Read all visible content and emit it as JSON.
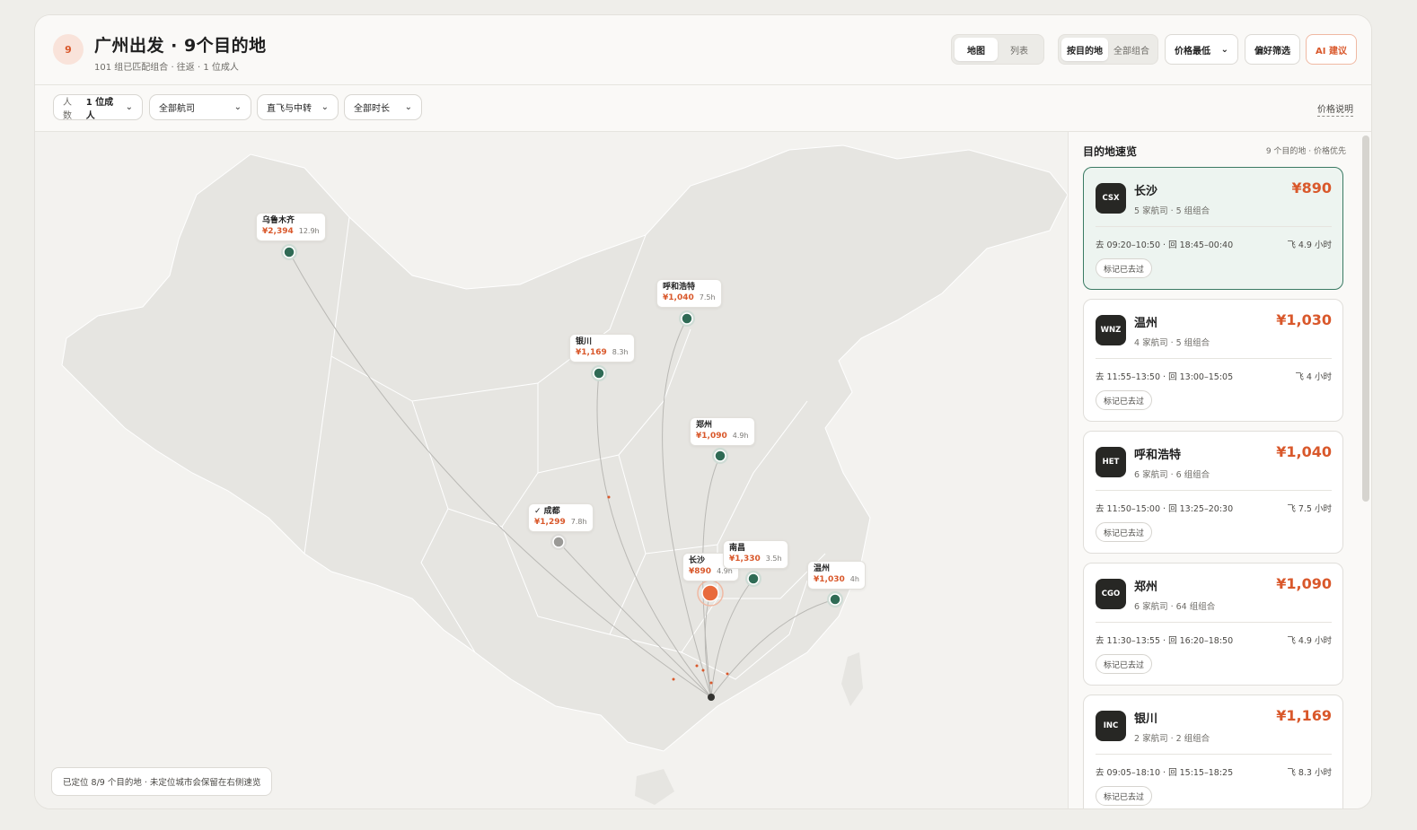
{
  "header": {
    "count": "9",
    "title": "广州出发 · 9个目的地",
    "subtitle": "101 组已匹配组合 · 往返 · 1 位成人",
    "view_toggle": [
      "地图",
      "列表"
    ],
    "group_toggle": [
      "按目的地",
      "全部组合"
    ],
    "sort_label": "价格最低",
    "prefs_label": "偏好筛选",
    "ai_label": "AI 建议"
  },
  "filters": {
    "people_label": "人数",
    "people_value": "1 位成人",
    "airline": "全部航司",
    "stops": "直飞与中转",
    "duration": "全部时长",
    "price_note": "价格说明"
  },
  "map": {
    "origin": "广州",
    "cities": [
      {
        "name": "乌鲁木齐",
        "price": "¥2,394",
        "hours": "12.9h",
        "status": "located"
      },
      {
        "name": "呼和浩特",
        "price": "¥1,040",
        "hours": "7.5h",
        "status": "located"
      },
      {
        "name": "银川",
        "price": "¥1,169",
        "hours": "8.3h",
        "status": "located"
      },
      {
        "name": "郑州",
        "price": "¥1,090",
        "hours": "4.9h",
        "status": "located"
      },
      {
        "name": "✓ 成都",
        "price": "¥1,299",
        "hours": "7.8h",
        "status": "visited"
      },
      {
        "name": "长沙",
        "price": "¥890",
        "hours": "4.9h",
        "status": "selected"
      },
      {
        "name": "南昌",
        "price": "¥1,330",
        "hours": "3.5h",
        "status": "located"
      },
      {
        "name": "温州",
        "price": "¥1,030",
        "hours": "4h",
        "status": "located"
      }
    ],
    "note": "已定位 8/9 个目的地 · 未定位城市会保留在右侧速览"
  },
  "panel": {
    "title": "目的地速览",
    "meta": "9 个目的地 · 价格优先",
    "cards": [
      {
        "code": "CSX",
        "city": "长沙",
        "sub": "5 家航司 · 5 组组合",
        "price": "¥890",
        "times": "去 09:20–10:50 · 回 18:45–00:40",
        "dur": "飞 4.9 小时",
        "mark": "标记已去过"
      },
      {
        "code": "WNZ",
        "city": "温州",
        "sub": "4 家航司 · 5 组组合",
        "price": "¥1,030",
        "times": "去 11:55–13:50 · 回 13:00–15:05",
        "dur": "飞 4 小时",
        "mark": "标记已去过"
      },
      {
        "code": "HET",
        "city": "呼和浩特",
        "sub": "6 家航司 · 6 组组合",
        "price": "¥1,040",
        "times": "去 11:50–15:00 · 回 13:25–20:30",
        "dur": "飞 7.5 小时",
        "mark": "标记已去过"
      },
      {
        "code": "CGO",
        "city": "郑州",
        "sub": "6 家航司 · 64 组组合",
        "price": "¥1,090",
        "times": "去 11:30–13:55 · 回 16:20–18:50",
        "dur": "飞 4.9 小时",
        "mark": "标记已去过"
      },
      {
        "code": "INC",
        "city": "银川",
        "sub": "2 家航司 · 2 组组合",
        "price": "¥1,169",
        "times": "去 09:05–18:10 · 回 15:15–18:25",
        "dur": "飞 8.3 小时",
        "mark": "标记已去过"
      }
    ]
  },
  "colors": {
    "accent": "#d9582b",
    "marker": "#2f6b55",
    "visited": "#9a9996",
    "selected_card": "#edf4f0"
  }
}
